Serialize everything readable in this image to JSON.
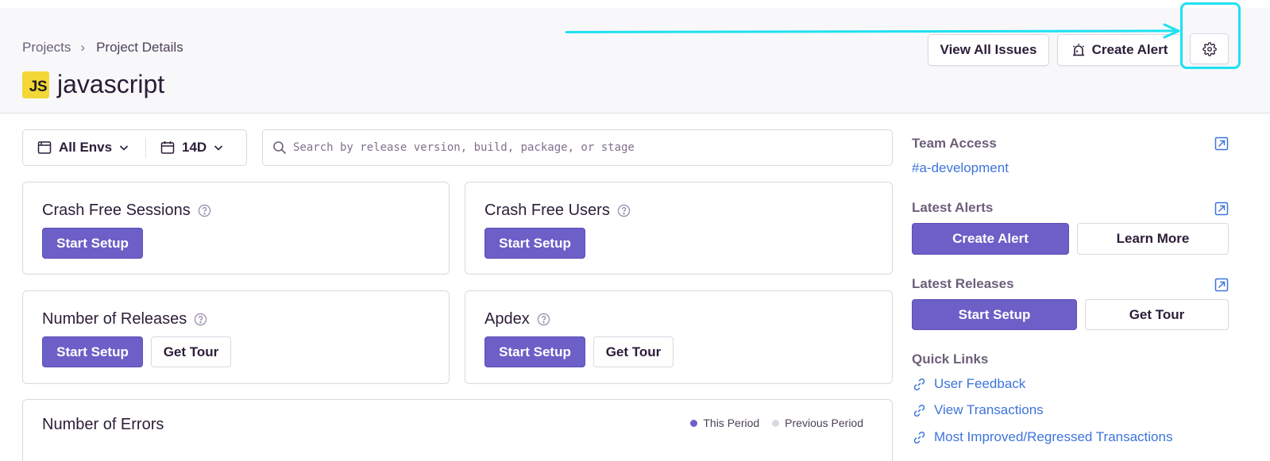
{
  "breadcrumb": {
    "root": "Projects",
    "separator": "›",
    "current": "Project Details"
  },
  "project": {
    "badge": "JS",
    "name": "javascript"
  },
  "header_actions": {
    "view_issues": "View All Issues",
    "create_alert": "Create Alert",
    "settings_icon": "gear-icon"
  },
  "filters": {
    "environment": "All Envs",
    "period": "14D"
  },
  "search": {
    "placeholder": "Search by release version, build, package, or stage"
  },
  "cards": {
    "crash_free_sessions": {
      "title": "Crash Free Sessions",
      "primary": "Start Setup"
    },
    "crash_free_users": {
      "title": "Crash Free Users",
      "primary": "Start Setup"
    },
    "number_of_releases": {
      "title": "Number of Releases",
      "primary": "Start Setup",
      "secondary": "Get Tour"
    },
    "apdex": {
      "title": "Apdex",
      "primary": "Start Setup",
      "secondary": "Get Tour"
    },
    "number_of_errors": {
      "title": "Number of Errors",
      "legend_this": "This Period",
      "legend_prev": "Previous Period"
    }
  },
  "sidebar": {
    "team_access": {
      "label": "Team Access",
      "team": "#a-development"
    },
    "latest_alerts": {
      "label": "Latest Alerts",
      "primary": "Create Alert",
      "secondary": "Learn More"
    },
    "latest_releases": {
      "label": "Latest Releases",
      "primary": "Start Setup",
      "secondary": "Get Tour"
    },
    "quick_links": {
      "label": "Quick Links",
      "items": [
        "User Feedback",
        "View Transactions",
        "Most Improved/Regressed Transactions"
      ]
    }
  },
  "colors": {
    "primary": "#6c5fc7",
    "link": "#3d74db",
    "highlight": "#1ee1f2",
    "js_badge": "#f2d737",
    "legend_prev": "#dcd6e2"
  }
}
